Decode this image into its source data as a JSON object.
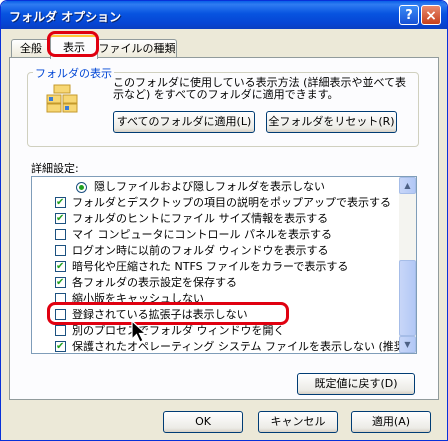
{
  "window": {
    "title": "フォルダ オプション",
    "help_label": "?",
    "close_label": "×"
  },
  "tabs": [
    {
      "label": "全般"
    },
    {
      "label": "表示"
    },
    {
      "label": "ファイルの種類"
    }
  ],
  "folder_view": {
    "title": "フォルダの表示",
    "description": "このフォルダに使用している表示方法 (詳細表示や並べて表示など) をすべてのフォルダに適用できます。",
    "apply_all_label": "すべてのフォルダに適用(L)",
    "reset_all_label": "全フォルダをリセット(R)"
  },
  "advanced": {
    "label": "詳細設定:",
    "items": [
      {
        "label": "隠しファイルおよび隠しフォルダを表示しない",
        "type": "radio",
        "checked": true
      },
      {
        "label": "フォルダとデスクトップの項目の説明をポップアップで表示する",
        "type": "checkbox",
        "checked": true
      },
      {
        "label": "フォルダのヒントにファイル サイズ情報を表示する",
        "type": "checkbox",
        "checked": true
      },
      {
        "label": "マイ コンピュータにコントロール パネルを表示する",
        "type": "checkbox",
        "checked": false
      },
      {
        "label": "ログオン時に以前のフォルダ ウィンドウを表示する",
        "type": "checkbox",
        "checked": false
      },
      {
        "label": "暗号化や圧縮された NTFS ファイルをカラーで表示する",
        "type": "checkbox",
        "checked": true
      },
      {
        "label": "各フォルダの表示設定を保存する",
        "type": "checkbox",
        "checked": true
      },
      {
        "label": "縮小版をキャッシュしない",
        "type": "checkbox",
        "checked": false
      },
      {
        "label": "登録されている拡張子は表示しない",
        "type": "checkbox",
        "checked": false
      },
      {
        "label": "別のプロセスでフォルダ ウィンドウを開く",
        "type": "checkbox",
        "checked": false
      },
      {
        "label": "保護されたオペレーティング システム ファイルを表示しない (推奨)",
        "type": "checkbox",
        "checked": true
      }
    ]
  },
  "buttons": {
    "restore_defaults": "既定値に戻す(D)",
    "ok": "OK",
    "cancel": "キャンセル",
    "apply": "適用(A)"
  },
  "colors": {
    "title_bar": "#0754e0",
    "highlight_annotation": "#e00010",
    "check_mark": "#21a121"
  }
}
